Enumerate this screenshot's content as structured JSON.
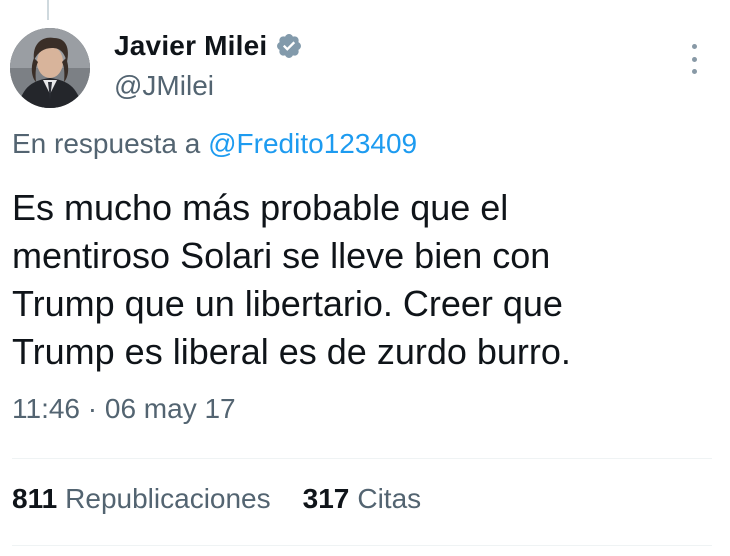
{
  "author": {
    "name": "Javier Milei",
    "handle": "@JMilei",
    "verified_icon": "verified-badge-icon",
    "badge_color": "#829aab"
  },
  "reply": {
    "prefix": "En respuesta a",
    "mention": "@Fredito123409"
  },
  "tweet": {
    "lines": [
      "Es mucho más probable que el",
      "mentiroso Solari se lleve bien con",
      "Trump que un libertario. Creer que",
      "Trump es liberal es de zurdo burro."
    ],
    "timestamp": "11:46 · 06 may 17"
  },
  "stats": {
    "reposts_count": "811",
    "reposts_label": "Republicaciones",
    "quotes_count": "317",
    "quotes_label": "Citas"
  },
  "colors": {
    "link": "#1d9bf0",
    "secondary_text": "#536471",
    "primary_text": "#0f1419"
  }
}
